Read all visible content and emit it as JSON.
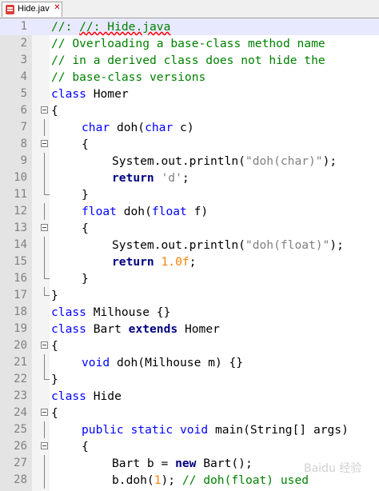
{
  "tab": {
    "title": "Hide.java",
    "label_visible": "Hide.jav",
    "close_glyph": "✕"
  },
  "line_numbers": [
    "1",
    "2",
    "3",
    "4",
    "5",
    "6",
    "7",
    "8",
    "9",
    "10",
    "11",
    "12",
    "13",
    "14",
    "15",
    "16",
    "17",
    "18",
    "19",
    "20",
    "21",
    "22",
    "23",
    "24",
    "25",
    "26",
    "27",
    "28"
  ],
  "code": {
    "l1": "//: Hide.java",
    "l2": "// Overloading a base-class method name",
    "l3": "// in a derived class does not hide the",
    "l4": "// base-class versions",
    "l5_kw": "class",
    "l5_rest": " Homer",
    "l6": "{",
    "l7_kw1": "char",
    "l7_mid": " doh(",
    "l7_kw2": "char",
    "l7_end": " c)",
    "l8": "{",
    "l9_a": "System.out.println(",
    "l9_str": "\"doh(char)\"",
    "l9_b": ");",
    "l10_kw": "return",
    "l10_str": "'d'",
    "l10_end": ";",
    "l11": "}",
    "l12_kw1": "float",
    "l12_mid": " doh(",
    "l12_kw2": "float",
    "l12_end": " f)",
    "l13": "{",
    "l14_a": "System.out.println(",
    "l14_str": "\"doh(float)\"",
    "l14_b": ");",
    "l15_kw": "return",
    "l15_num": "1.0f",
    "l15_end": ";",
    "l16": "}",
    "l17": "}",
    "l18_kw": "class",
    "l18_rest": " Milhouse {}",
    "l19_kw": "class",
    "l19_mid": " Bart ",
    "l19_kw2": "extends",
    "l19_rest": " Homer",
    "l20": "{",
    "l21_kw": "void",
    "l21_rest": " doh(Milhouse m) {}",
    "l22": "}",
    "l23_kw": "class",
    "l23_rest": " Hide",
    "l24": "{",
    "l25_kw": "public static void",
    "l25_rest": " main(String[] args)",
    "l26": "{",
    "l27_a": "Bart b = ",
    "l27_kw": "new",
    "l27_b": " Bart();",
    "l28_a": "b.doh(",
    "l28_num": "1",
    "l28_b": "); ",
    "l28_cm": "// doh(float) used"
  },
  "watermark": "Baidu 经验",
  "colors": {
    "keyword": "#0000ff",
    "keyword_bold": "#000080",
    "comment": "#008000",
    "string": "#808080",
    "number": "#ff8000",
    "current_line": "#e8e8ff"
  }
}
